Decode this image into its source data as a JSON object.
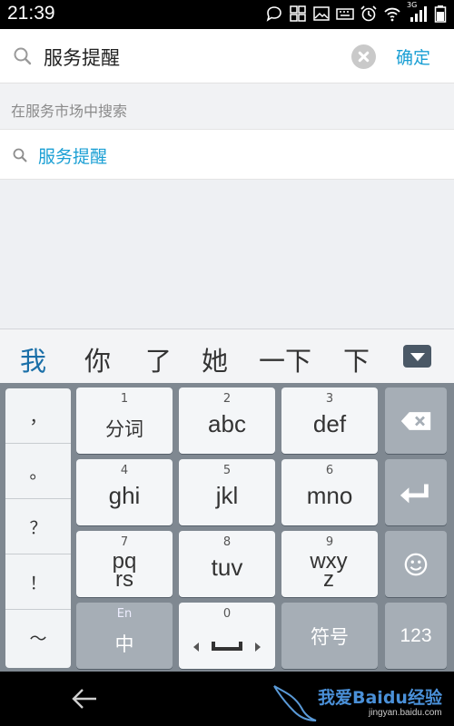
{
  "status_bar": {
    "time": "21:39",
    "network_label": "3G",
    "icons": [
      "chat-icon",
      "grid-icon",
      "image-icon",
      "keyboard-icon",
      "alarm-icon",
      "wifi-icon",
      "signal-icon",
      "battery-icon"
    ]
  },
  "search": {
    "query": "服务提醒",
    "confirm_label": "确定"
  },
  "section_header": "在服务市场中搜索",
  "results": [
    {
      "label": "服务提醒"
    }
  ],
  "candidates": [
    "我",
    "你",
    "了",
    "她",
    "一下",
    "下"
  ],
  "keyboard": {
    "punctuation": [
      "，",
      "。",
      "？",
      "！",
      "～"
    ],
    "keys": [
      {
        "num": "1",
        "label": "分词"
      },
      {
        "num": "2",
        "label": "abc"
      },
      {
        "num": "3",
        "label": "def"
      },
      {
        "num": "4",
        "label": "ghi"
      },
      {
        "num": "5",
        "label": "jkl"
      },
      {
        "num": "6",
        "label": "mno"
      },
      {
        "num": "7",
        "label": "pqrs"
      },
      {
        "num": "8",
        "label": "tuv"
      },
      {
        "num": "9",
        "label": "wxyz"
      }
    ],
    "lang_key": {
      "top": "En",
      "label": "中"
    },
    "space_key": {
      "num": "0"
    },
    "symbol_key": "符号",
    "numeric_key": "123"
  },
  "watermark": {
    "text": "我爱Baidu经验",
    "url": "jingyan.baidu.com"
  },
  "colors": {
    "accent": "#1a9fd4",
    "keyboard_bg": "#7f8891",
    "status_bg": "#000000"
  }
}
